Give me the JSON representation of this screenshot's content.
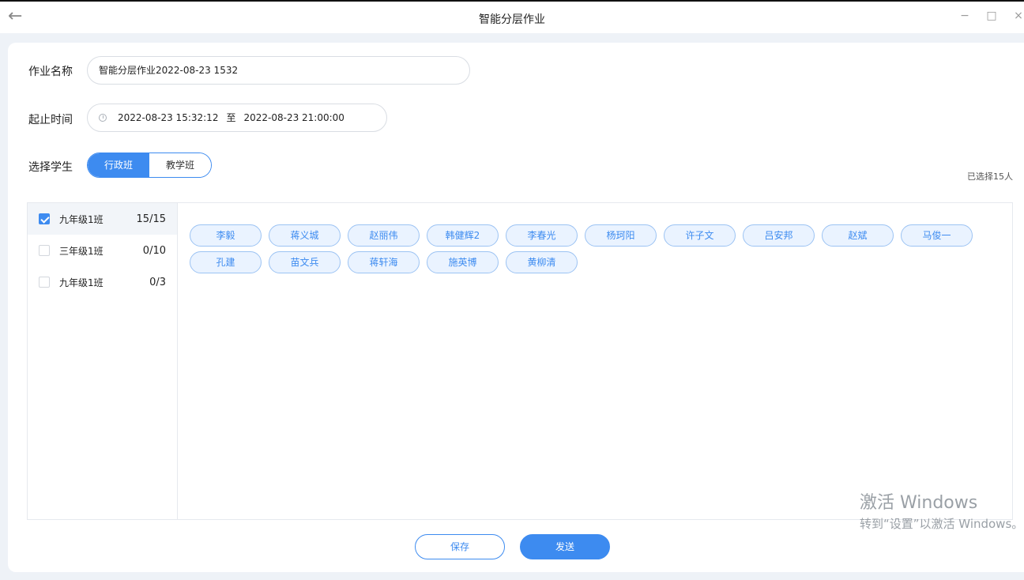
{
  "window": {
    "title": "智能分层作业",
    "back_glyph": "←",
    "minimize_glyph": "−",
    "maximize_glyph": "□",
    "close_glyph": "×"
  },
  "form": {
    "name_label": "作业名称",
    "name_value": "智能分层作业2022-08-23 1532",
    "time_label": "起止时间",
    "start_time": "2022-08-23 15:32:12",
    "to_text": "至",
    "end_time": "2022-08-23 21:00:00",
    "students_label": "选择学生",
    "tabs": [
      {
        "label": "行政班",
        "active": true
      },
      {
        "label": "教学班",
        "active": false
      }
    ],
    "selected_summary": "已选择15人"
  },
  "classes": [
    {
      "name": "九年级1班",
      "count": "15/15",
      "checked": true
    },
    {
      "name": "三年级1班",
      "count": "0/10",
      "checked": false
    },
    {
      "name": "九年级1班",
      "count": "0/3",
      "checked": false
    }
  ],
  "students": [
    "李毅",
    "蒋义城",
    "赵丽伟",
    "韩健辉2",
    "李春光",
    "杨珂阳",
    "许子文",
    "吕安邦",
    "赵斌",
    "马俊一",
    "孔建",
    "苗文兵",
    "蒋轩海",
    "施英博",
    "黄柳清"
  ],
  "actions": {
    "save_label": "保存",
    "send_label": "发送"
  },
  "watermark": {
    "line1": "激活 Windows",
    "line2": "转到“设置”以激活 Windows。"
  },
  "colors": {
    "accent": "#3d8bf0",
    "chip_bg": "#eaf3ff",
    "page_bg": "#eef2f7"
  }
}
